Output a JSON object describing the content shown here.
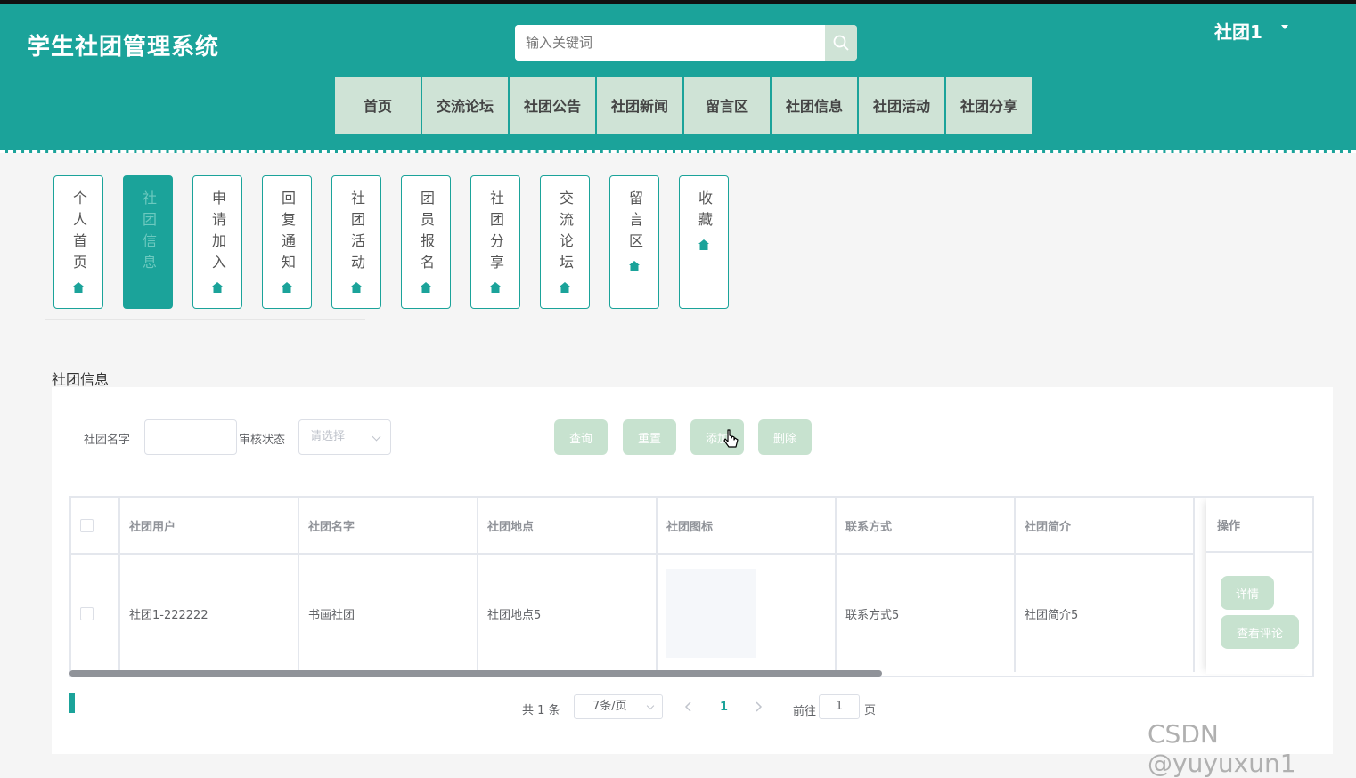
{
  "header": {
    "title": "学生社团管理系统",
    "search_placeholder": "输入关键词",
    "user": "社团1",
    "nav": [
      "首页",
      "交流论坛",
      "社团公告",
      "社团新闻",
      "留言区",
      "社团信息",
      "社团活动",
      "社团分享"
    ]
  },
  "sidebar": {
    "items": [
      {
        "label": "个人首页"
      },
      {
        "label": "社团信息"
      },
      {
        "label": "申请加入"
      },
      {
        "label": "回复通知"
      },
      {
        "label": "社团活动"
      },
      {
        "label": "团员报名"
      },
      {
        "label": "社团分享"
      },
      {
        "label": "交流论坛"
      },
      {
        "label": "留言区"
      },
      {
        "label": "收藏"
      }
    ],
    "active_index": 1
  },
  "main": {
    "section_title": "社团信息",
    "filters": {
      "name_label": "社团名字",
      "status_label": "审核状态",
      "status_placeholder": "请选择"
    },
    "buttons": {
      "query": "查询",
      "reset": "重置",
      "add": "添加",
      "delete": "删除"
    },
    "table": {
      "headers": [
        "社团用户",
        "社团名字",
        "社团地点",
        "社团图标",
        "联系方式",
        "社团简介",
        "操作"
      ],
      "rows": [
        {
          "user": "社团1-222222",
          "name": "书画社团",
          "location": "社团地点5",
          "contact": "联系方式5",
          "intro": "社团简介5"
        }
      ],
      "row_actions": {
        "detail": "详情",
        "comments": "查看评论"
      }
    },
    "pagination": {
      "total": "共 1 条",
      "page_size": "7条/页",
      "current_page": "1",
      "goto_label": "前往",
      "goto_value": "1",
      "page_suffix": "页"
    }
  },
  "colors": {
    "primary": "#1ba39a",
    "nav_item_bg": "#cfe3d6",
    "button_bg": "#c7e2cf"
  },
  "watermark": "CSDN @yuyuxun1"
}
